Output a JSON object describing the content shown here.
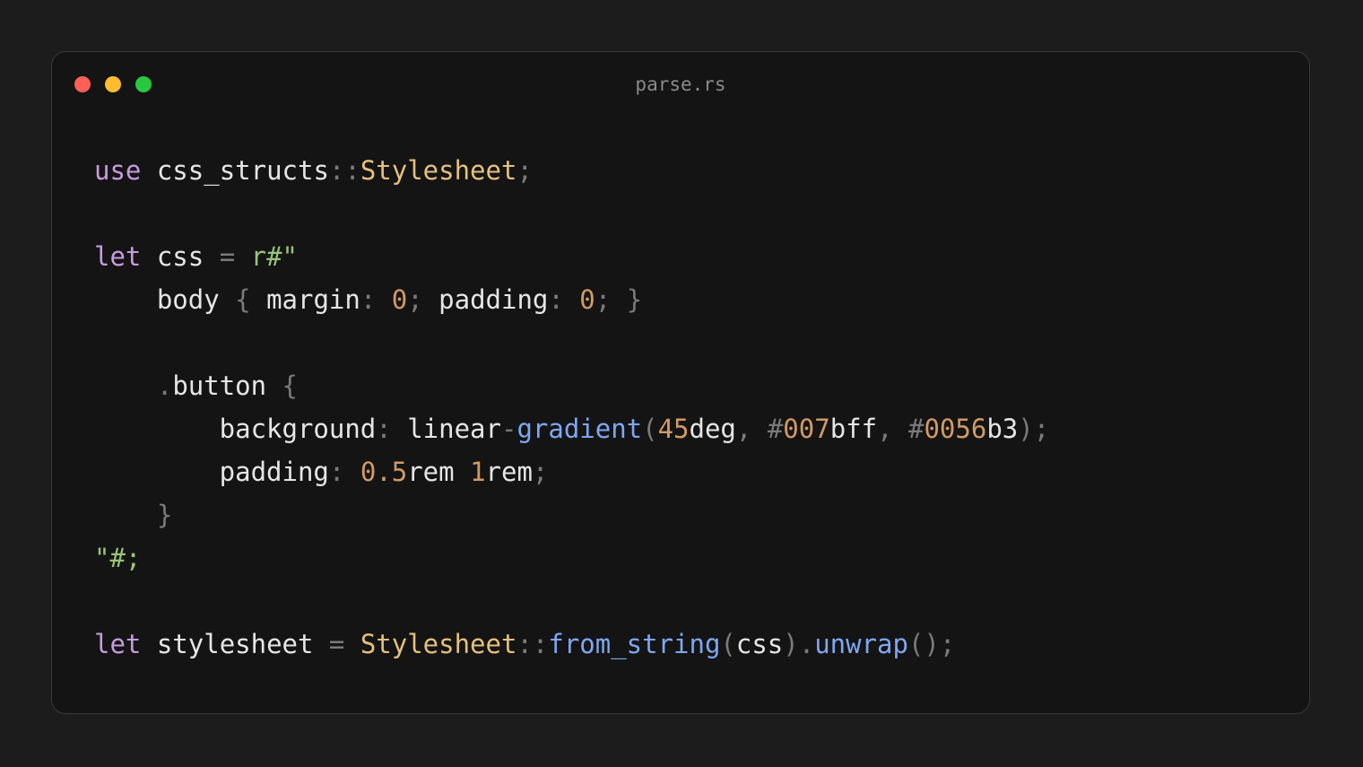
{
  "window": {
    "title": "parse.rs",
    "controls": [
      {
        "name": "close",
        "color": "#ff5f57"
      },
      {
        "name": "minimize",
        "color": "#febc2e"
      },
      {
        "name": "maximize",
        "color": "#28c840"
      }
    ]
  },
  "colors": {
    "keyword": "#c79bdf",
    "text": "#e6e6e6",
    "punct": "#7a7a7a",
    "type": "#e5c17c",
    "string": "#98c379",
    "number": "#d19a66",
    "function": "#7ea7f2"
  },
  "code": {
    "lines": [
      [
        {
          "t": "use",
          "k": "keyword"
        },
        {
          "t": " css_structs",
          "k": "text"
        },
        {
          "t": "::",
          "k": "punct"
        },
        {
          "t": "Stylesheet",
          "k": "type"
        },
        {
          "t": ";",
          "k": "punct"
        }
      ],
      [],
      [
        {
          "t": "let",
          "k": "keyword"
        },
        {
          "t": " css ",
          "k": "text"
        },
        {
          "t": "=",
          "k": "punct"
        },
        {
          "t": " r#\"",
          "k": "string"
        }
      ],
      [
        {
          "t": "    body ",
          "k": "text"
        },
        {
          "t": "{",
          "k": "punct"
        },
        {
          "t": " margin",
          "k": "text"
        },
        {
          "t": ":",
          "k": "punct"
        },
        {
          "t": " 0",
          "k": "number"
        },
        {
          "t": ";",
          "k": "punct"
        },
        {
          "t": " padding",
          "k": "text"
        },
        {
          "t": ":",
          "k": "punct"
        },
        {
          "t": " 0",
          "k": "number"
        },
        {
          "t": ";",
          "k": "punct"
        },
        {
          "t": " }",
          "k": "punct"
        }
      ],
      [],
      [
        {
          "t": "    .",
          "k": "punct"
        },
        {
          "t": "button ",
          "k": "text"
        },
        {
          "t": "{",
          "k": "punct"
        }
      ],
      [
        {
          "t": "        background",
          "k": "text"
        },
        {
          "t": ":",
          "k": "punct"
        },
        {
          "t": " linear",
          "k": "text"
        },
        {
          "t": "-",
          "k": "punct"
        },
        {
          "t": "gradient",
          "k": "function"
        },
        {
          "t": "(",
          "k": "punct"
        },
        {
          "t": "45",
          "k": "number"
        },
        {
          "t": "deg",
          "k": "text"
        },
        {
          "t": ",",
          "k": "punct"
        },
        {
          "t": " #",
          "k": "punct"
        },
        {
          "t": "007",
          "k": "number"
        },
        {
          "t": "bff",
          "k": "text"
        },
        {
          "t": ",",
          "k": "punct"
        },
        {
          "t": " #",
          "k": "punct"
        },
        {
          "t": "0056",
          "k": "number"
        },
        {
          "t": "b3",
          "k": "text"
        },
        {
          "t": ");",
          "k": "punct"
        }
      ],
      [
        {
          "t": "        padding",
          "k": "text"
        },
        {
          "t": ":",
          "k": "punct"
        },
        {
          "t": " 0.5",
          "k": "number"
        },
        {
          "t": "rem",
          "k": "text"
        },
        {
          "t": " 1",
          "k": "number"
        },
        {
          "t": "rem",
          "k": "text"
        },
        {
          "t": ";",
          "k": "punct"
        }
      ],
      [
        {
          "t": "    }",
          "k": "punct"
        }
      ],
      [
        {
          "t": "\"#;",
          "k": "string"
        }
      ],
      [],
      [
        {
          "t": "let",
          "k": "keyword"
        },
        {
          "t": " stylesheet ",
          "k": "text"
        },
        {
          "t": "=",
          "k": "punct"
        },
        {
          "t": " Stylesheet",
          "k": "type"
        },
        {
          "t": "::",
          "k": "punct"
        },
        {
          "t": "from_string",
          "k": "function"
        },
        {
          "t": "(",
          "k": "punct"
        },
        {
          "t": "css",
          "k": "text"
        },
        {
          "t": ").",
          "k": "punct"
        },
        {
          "t": "unwrap",
          "k": "function"
        },
        {
          "t": "();",
          "k": "punct"
        }
      ]
    ]
  }
}
